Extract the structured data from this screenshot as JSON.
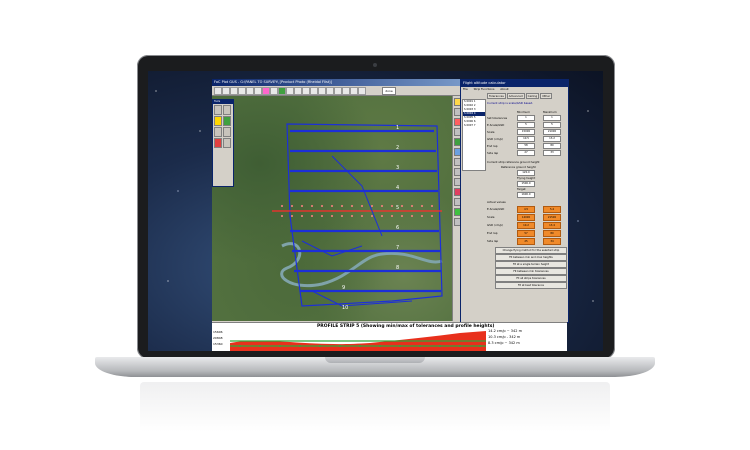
{
  "app": {
    "title": "FoC Plot GUS - G:\\PANEL TO SURVEY\\ [Product Photo (Rheidol Flist)]",
    "map_toolbar_label": "done",
    "tool_window_title": "Tools",
    "strip_numbers": [
      "1",
      "2",
      "3",
      "4",
      "5",
      "6",
      "7",
      "8",
      "9",
      "10"
    ]
  },
  "calculator": {
    "title": "Flight altitude calculator",
    "menu": [
      "File",
      "Strip Functions",
      "About"
    ],
    "tabs": [
      "Tolerances",
      "Advanced",
      "Ceiling",
      "Other"
    ],
    "strips": [
      "S 0001 1",
      "S 0002 2",
      "S 0003 3",
      "S 0004 4",
      "S 0005 5",
      "S 0006 6",
      "S 0007 7"
    ],
    "selected_strip_index": 3,
    "instruction": "Current strip is scale/GSD based.",
    "tolerance_labels": {
      "minimum": "Minimum",
      "maximum": "Maximum"
    },
    "rows": [
      {
        "label": "Set tolerances",
        "min": "1",
        "max": "1"
      },
      {
        "label": "E-Scale/GSD",
        "min": "5",
        "max": "5"
      },
      {
        "label": "Scale",
        "min": "15000",
        "max": "21000"
      },
      {
        "label": "GSD (cm/p)",
        "min": "10.5",
        "max": "13.2"
      },
      {
        "label": "End lap",
        "min": "58",
        "max": "80"
      },
      {
        "label": "Side lap",
        "min": "27",
        "max": "33"
      }
    ],
    "reference": {
      "heading": "Current strip reference ground height",
      "label": "Reference ground height",
      "value": "120.0"
    },
    "flying": {
      "label": "Flying height",
      "value": "1500.0"
    },
    "target": {
      "label": "Target",
      "value": "1600.0"
    },
    "actual": {
      "label": "Actual values",
      "rows": [
        {
          "label": "E-Scale/GSD",
          "min": "4.5",
          "max": "5.4"
        },
        {
          "label": "Scale",
          "min": "14000",
          "max": "21500"
        },
        {
          "label": "GSD (cm/p)",
          "min": "10.2",
          "max": "13.4"
        },
        {
          "label": "End lap",
          "min": "57",
          "max": "80"
        },
        {
          "label": "Side lap",
          "min": "25",
          "max": "34"
        }
      ]
    },
    "buttons": [
      "Change flying method for the selected strip",
      "Fit between min and max heights",
      "Fit at a single terrain height",
      "Fit between min tolerances",
      "Fit all strips tolerances",
      "Fit at best tolerance"
    ]
  },
  "profile": {
    "title": "PROFILE STRIP 5  (Showing min/max of tolerances and profile heights)",
    "left_labels": [
      "15606",
      "20848",
      "15360"
    ],
    "right_labels": [
      "14.2 cm/p ~ 342 m",
      "10.3 cm/p - 342 m",
      "8.3 cm/p ~ 342 m"
    ]
  },
  "colors": {
    "strip_blue": "#1c2fd8",
    "flight_line": "#ff2b2b",
    "profile_fill": "#e8301c",
    "profile_green": "#2fa83c",
    "orange_field": "#f08a2a"
  }
}
